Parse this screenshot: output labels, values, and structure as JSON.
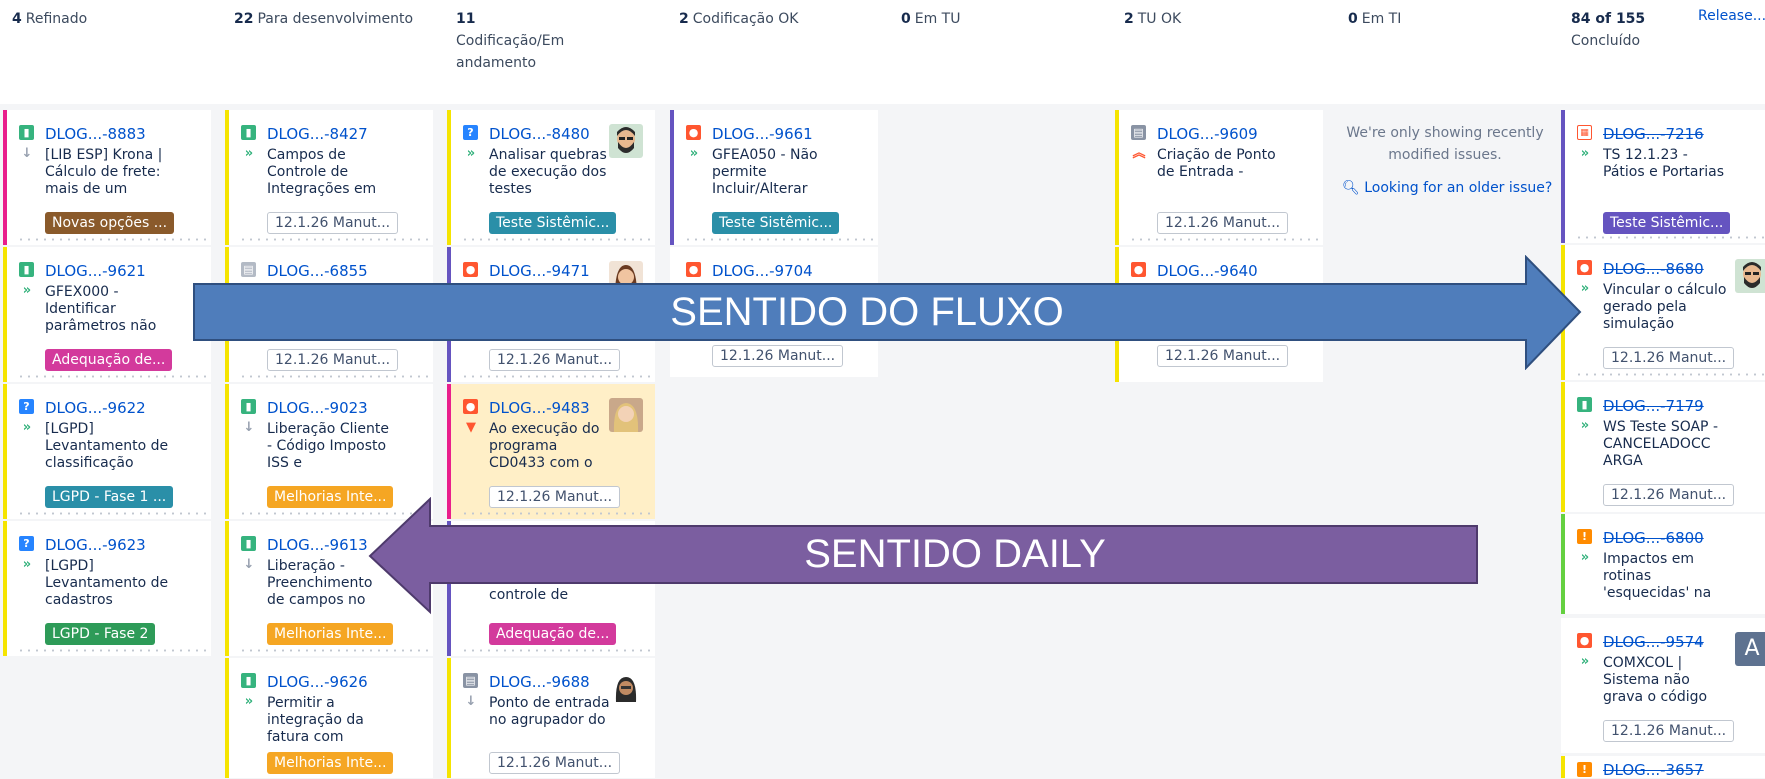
{
  "columns": [
    {
      "count": "4",
      "name": "Refinado"
    },
    {
      "count": "22",
      "name": "Para desenvolvimento"
    },
    {
      "count": "11",
      "name": "Codificação/Em andamento"
    },
    {
      "count": "2",
      "name": "Codificação OK"
    },
    {
      "count": "0",
      "name": "Em TU"
    },
    {
      "count": "2",
      "name": "TU OK"
    },
    {
      "count": "0",
      "name": "Em TI"
    },
    {
      "count": "84 of 155",
      "name": "Concluído"
    }
  ],
  "release_link": "Release...",
  "cards": {
    "c8883": {
      "key": "DLOG...-8883",
      "summary": "[LIB ESP] Krona | Cálculo de frete: mais de um",
      "badge": "Novas opções ..."
    },
    "c9621": {
      "key": "DLOG...-9621",
      "summary": "GFEX000 - Identificar parâmetros não",
      "badge": "Adequação de..."
    },
    "c9622": {
      "key": "DLOG...-9622",
      "summary": "[LGPD] Levantamento de classificação",
      "badge": "LGPD - Fase 1 ..."
    },
    "c9623": {
      "key": "DLOG...-9623",
      "summary": "[LGPD] Levantamento de cadastros",
      "badge": "LGPD - Fase 2"
    },
    "c8427": {
      "key": "DLOG...-8427",
      "summary": "Campos de Controle de Integrações em",
      "badge": "12.1.26 Manut..."
    },
    "c6855": {
      "key": "DLOG...-6855",
      "summary": "",
      "badge": "12.1.26 Manut..."
    },
    "c9023": {
      "key": "DLOG...-9023",
      "summary": "Liberação Cliente - Código Imposto ISS e",
      "badge": "Melhorias Inte..."
    },
    "c9613": {
      "key": "DLOG...-9613",
      "summary": "Liberação - Preenchimento de campos no",
      "badge": "Melhorias Inte..."
    },
    "c9626": {
      "key": "DLOG...-9626",
      "summary": "Permitir a integração da fatura com",
      "badge": "Melhorias Inte..."
    },
    "c8480": {
      "key": "DLOG...-8480",
      "summary": "Analisar quebras de execução dos testes",
      "badge": "Teste Sistêmic..."
    },
    "c9471": {
      "key": "DLOG...-9471",
      "summary": "",
      "badge": "12.1.26 Manut..."
    },
    "c9483": {
      "key": "DLOG...-9483",
      "summary": "Ao execução do programa CD0433 com o",
      "badge": "12.1.26 Manut..."
    },
    "cX": {
      "key": "",
      "summary": "controle de",
      "badge": "Adequação de..."
    },
    "c9688": {
      "key": "DLOG...-9688",
      "summary": "Ponto de entrada no agrupador do",
      "badge": "12.1.26 Manut..."
    },
    "c9661": {
      "key": "DLOG...-9661",
      "summary": "GFEA050 - Não permite Incluir/Alterar",
      "badge": "Teste Sistêmic..."
    },
    "c9704": {
      "key": "DLOG...-9704",
      "summary": "",
      "badge": "12.1.26 Manut..."
    },
    "c9609": {
      "key": "DLOG...-9609",
      "summary": "Criação de Ponto de Entrada -",
      "badge": "12.1.26 Manut..."
    },
    "c9640": {
      "key": "DLOG...-9640",
      "summary": "",
      "badge": "12.1.26 Manut..."
    },
    "c7216": {
      "key": "DLOG...-7216",
      "summary": "TS 12.1.23 - Pátios e Portarias",
      "badge": "Teste Sistêmic..."
    },
    "c8680": {
      "key": "DLOG...-8680",
      "summary": "Vincular o cálculo gerado pela simulação",
      "badge": "12.1.26 Manut..."
    },
    "c7179": {
      "key": "DLOG...-7179",
      "summary": "WS Teste SOAP - CANCELADOCC ARGA",
      "badge": "12.1.26 Manut..."
    },
    "c6800": {
      "key": "DLOG...-6800",
      "summary": "Impactos em rotinas 'esquecidas' na",
      "badge": ""
    },
    "c9574": {
      "key": "DLOG...-9574",
      "summary": "COMXCOL | Sistema não grava o código",
      "badge": "12.1.26 Manut..."
    },
    "c3657": {
      "key": "DLOG...-3657",
      "summary": "",
      "badge": ""
    }
  },
  "em_ti": {
    "notice": "We're only showing recently modified issues.",
    "link": "Looking for an older issue?"
  },
  "avatar_letter": "A",
  "arrows": {
    "flow": "SENTIDO DO FLUXO",
    "daily": "SENTIDO DAILY"
  },
  "colors": {
    "story": "#36b37e",
    "bug": "#ff5630",
    "question": "#2684ff",
    "improvement": "#ff8b00",
    "flow_arrow": "#4f7dbb",
    "daily_arrow": "#7b5ea0"
  }
}
